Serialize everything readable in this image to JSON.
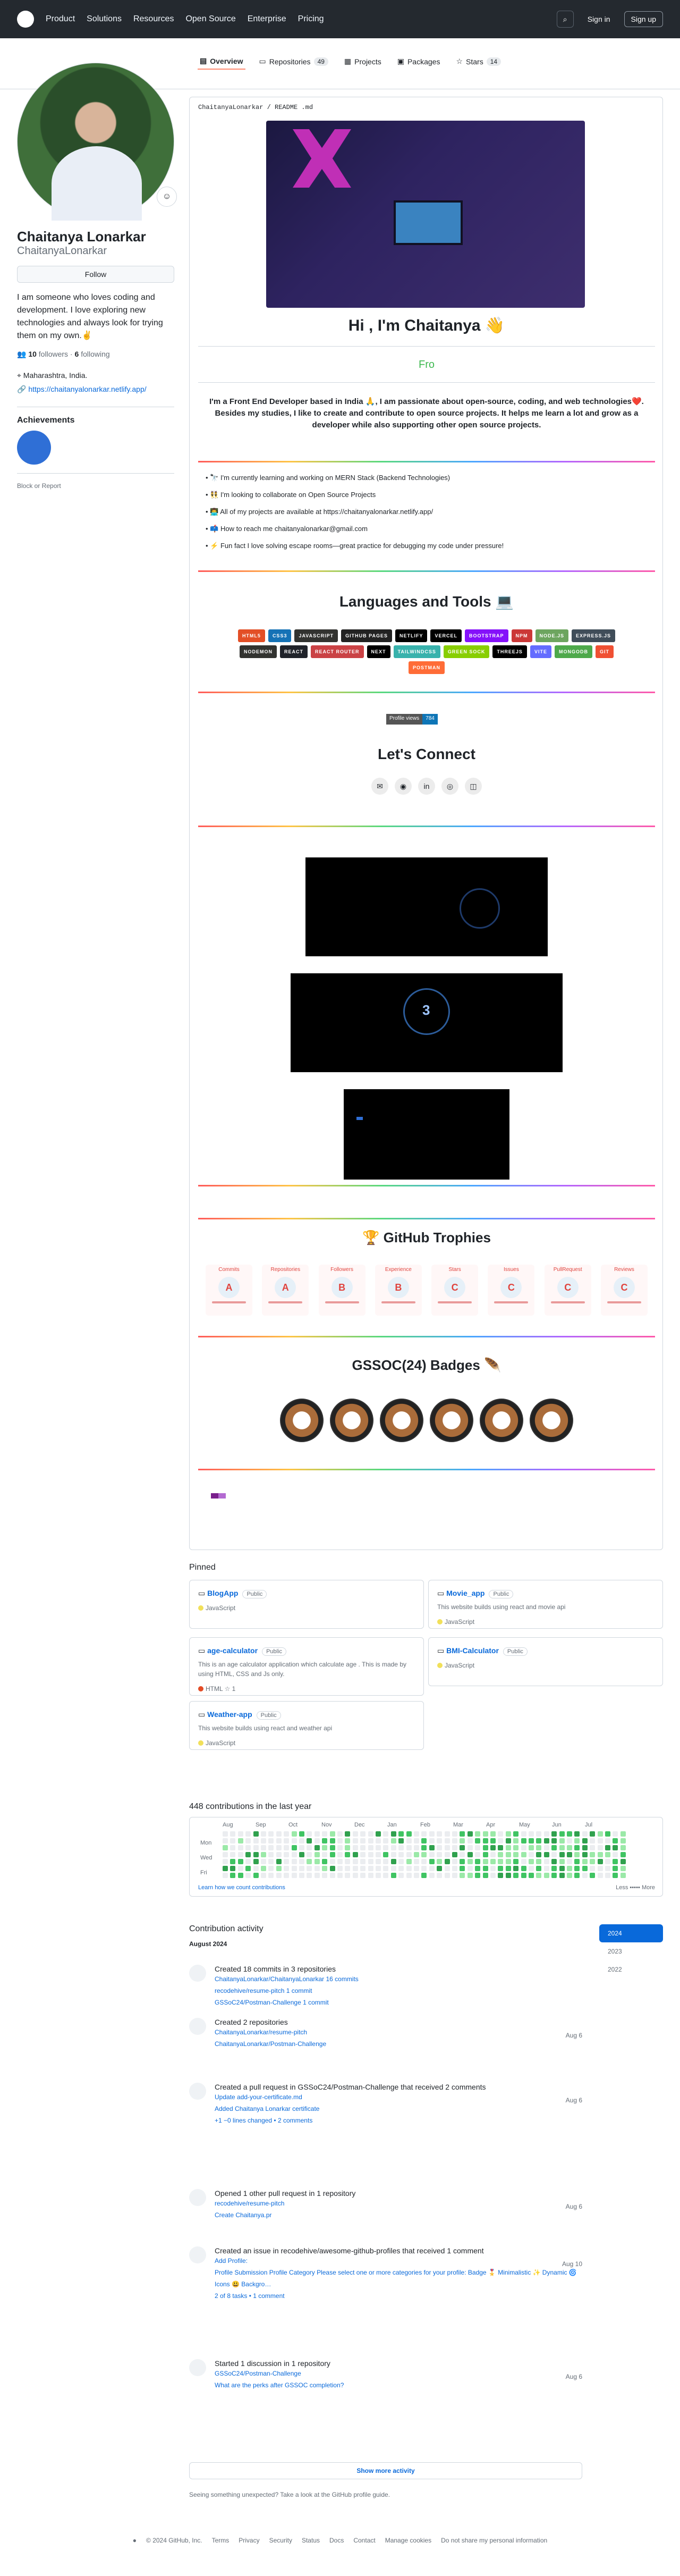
{
  "header": {
    "nav": [
      "Product",
      "Solutions",
      "Resources",
      "Open Source",
      "Enterprise",
      "Pricing"
    ],
    "signin": "Sign in",
    "signup": "Sign up"
  },
  "tabs": [
    {
      "label": "Overview",
      "count": ""
    },
    {
      "label": "Repositories",
      "count": "49"
    },
    {
      "label": "Projects",
      "count": ""
    },
    {
      "label": "Packages",
      "count": ""
    },
    {
      "label": "Stars",
      "count": "14"
    }
  ],
  "profile": {
    "name": "Chaitanya Lonarkar",
    "login": "ChaitanyaLonarkar",
    "follow": "Follow",
    "bio": "I am someone who loves coding and development. I love exploring new technologies and always look for trying them on my own.✌️",
    "followers": "10",
    "followers_label": "followers",
    "following": "6",
    "following_label": "following",
    "location": "Maharashtra, India.",
    "website": "https://chaitanyalonarkar.netlify.app/",
    "achievements_title": "Achievements",
    "block": "Block or Report"
  },
  "readme": {
    "path": "ChaitanyaLonarkar / README .md",
    "hi": "Hi , I'm Chaitanya 👋",
    "fro": "Fro",
    "intro": "I'm a Front End Developer based in India 🙏, I am passionate about open-source, coding, and web technologies❤️. Besides my studies, I like to create and contribute to open source projects. It helps me learn a lot and grow as a developer while also supporting other open source projects.",
    "bullets": [
      {
        "text": "🔭 I'm currently learning and working on MERN Stack (Backend Technologies)"
      },
      {
        "text": "👯 I'm looking to collaborate on Open Source Projects"
      },
      {
        "text": "👨‍💻 All of my projects are available at https://chaitanyalonarkar.netlify.app/"
      },
      {
        "text": "📫 How to reach me chaitanyalonarkar@gmail.com"
      },
      {
        "text": "⚡ Fun fact I love solving escape rooms—great practice for debugging my code under pressure!"
      }
    ],
    "languages_title": "Languages and Tools 💻",
    "badges": [
      {
        "label": "HTML5",
        "color": "#e34f26"
      },
      {
        "label": "CSS3",
        "color": "#1572b6"
      },
      {
        "label": "JAVASCRIPT",
        "color": "#323330"
      },
      {
        "label": "GITHUB PAGES",
        "color": "#222222"
      },
      {
        "label": "NETLIFY",
        "color": "#000000"
      },
      {
        "label": "VERCEL",
        "color": "#000000"
      },
      {
        "label": "BOOTSTRAP",
        "color": "#8511fa"
      },
      {
        "label": "NPM",
        "color": "#cb3837"
      },
      {
        "label": "NODE.JS",
        "color": "#6da55f"
      },
      {
        "label": "EXPRESS.JS",
        "color": "#404d59"
      },
      {
        "label": "NODEMON",
        "color": "#323330"
      },
      {
        "label": "REACT",
        "color": "#20232a"
      },
      {
        "label": "REACT ROUTER",
        "color": "#ca4245"
      },
      {
        "label": "NEXT",
        "color": "#000000"
      },
      {
        "label": "TAILWINDCSS",
        "color": "#38b2ac"
      },
      {
        "label": "GREEN SOCK",
        "color": "#88ce02"
      },
      {
        "label": "THREEJS",
        "color": "#000000"
      },
      {
        "label": "VITE",
        "color": "#646cff"
      },
      {
        "label": "MONGODB",
        "color": "#4ea94b"
      },
      {
        "label": "GIT",
        "color": "#f05033"
      },
      {
        "label": "POSTMAN",
        "color": "#ff6c37"
      }
    ],
    "views_label": "Profile views",
    "views_count": "784",
    "connect_title": "Let's Connect",
    "spinner_number": "3",
    "trophies_title": "🏆 GitHub Trophies",
    "trophies": [
      {
        "title": "Commits",
        "letter": "A"
      },
      {
        "title": "Repositories",
        "letter": "A"
      },
      {
        "title": "Followers",
        "letter": "B"
      },
      {
        "title": "Experience",
        "letter": "B"
      },
      {
        "title": "Stars",
        "letter": "C"
      },
      {
        "title": "Issues",
        "letter": "C"
      },
      {
        "title": "PullRequest",
        "letter": "C"
      },
      {
        "title": "Reviews",
        "letter": "C"
      }
    ],
    "gssoc_title": "GSSOC(24) Badges 🪶"
  },
  "pinned": {
    "title": "Pinned",
    "items": [
      {
        "name": "BlogApp",
        "vis": "Public",
        "desc": "",
        "lang": "JavaScript",
        "color": "#f1e05a",
        "stars": ""
      },
      {
        "name": "Movie_app",
        "vis": "Public",
        "desc": "This website builds using react and movie api",
        "lang": "JavaScript",
        "color": "#f1e05a",
        "stars": ""
      },
      {
        "name": "age-calculator",
        "vis": "Public",
        "desc": "This is an age calculator application which calculate age . This is made by using HTML, CSS and Js only.",
        "lang": "HTML",
        "color": "#e34c26",
        "stars": "1"
      },
      {
        "name": "BMI-Calculator",
        "vis": "Public",
        "desc": "",
        "lang": "JavaScript",
        "color": "#f1e05a",
        "stars": ""
      },
      {
        "name": "Weather-app",
        "vis": "Public",
        "desc": "This website builds using react and weather api",
        "lang": "JavaScript",
        "color": "#f1e05a",
        "stars": ""
      }
    ]
  },
  "contrib": {
    "title": "448 contributions in the last year",
    "months": [
      "Aug",
      "Sep",
      "Oct",
      "Nov",
      "Dec",
      "Jan",
      "Feb",
      "Mar",
      "Apr",
      "May",
      "Jun",
      "Jul"
    ],
    "days": [
      "Mon",
      "Wed",
      "Fri"
    ],
    "learn": "Learn how we count contributions",
    "less": "Less",
    "more": "More"
  },
  "activity": {
    "title": "Contribution activity",
    "month": "August 2024",
    "years": [
      "2024",
      "2023",
      "2022"
    ],
    "events": [
      {
        "title": "Created 18 commits in 3 repositories",
        "lines": [
          "ChaitanyaLonarkar/ChaitanyaLonarkar 16 commits",
          "recodehive/resume-pitch 1 commit",
          "GSSoC24/Postman-Challenge 1 commit"
        ],
        "date": ""
      },
      {
        "title": "Created 2 repositories",
        "lines": [
          "ChaitanyaLonarkar/resume-pitch",
          "ChaitanyaLonarkar/Postman-Challenge"
        ],
        "date": "Aug 6"
      },
      {
        "title": "Created a pull request in GSSoC24/Postman-Challenge that received 2 comments",
        "lines": [
          "Update add-your-certificate.md",
          "Added Chaitanya Lonarkar certificate",
          "+1 −0 lines changed • 2 comments"
        ],
        "date": "Aug 6"
      },
      {
        "title": "Opened 1 other pull request in 1 repository",
        "lines": [
          "recodehive/resume-pitch",
          "Create Chaitanya.pr"
        ],
        "date": "Aug 6"
      },
      {
        "title": "Created an issue in recodehive/awesome-github-profiles that received 1 comment",
        "lines": [
          "Add Profile:",
          "Profile Submission Profile Category Please select one or more categories for your profile: Badge 🎖️ Minimalistic ✨ Dynamic 🌀 Icons 😃 Backgro…",
          "2 of 8 tasks • 1 comment"
        ],
        "date": "Aug 10"
      },
      {
        "title": "Started 1 discussion in 1 repository",
        "lines": [
          "GSSoC24/Postman-Challenge",
          "What are the perks after GSSOC completion?"
        ],
        "date": "Aug 6"
      }
    ],
    "show_more": "Show more activity",
    "tip": "Seeing something unexpected? Take a look at the GitHub profile guide."
  },
  "footer": {
    "items": [
      "© 2024 GitHub, Inc.",
      "Terms",
      "Privacy",
      "Security",
      "Status",
      "Docs",
      "Contact",
      "Manage cookies",
      "Do not share my personal information"
    ]
  }
}
